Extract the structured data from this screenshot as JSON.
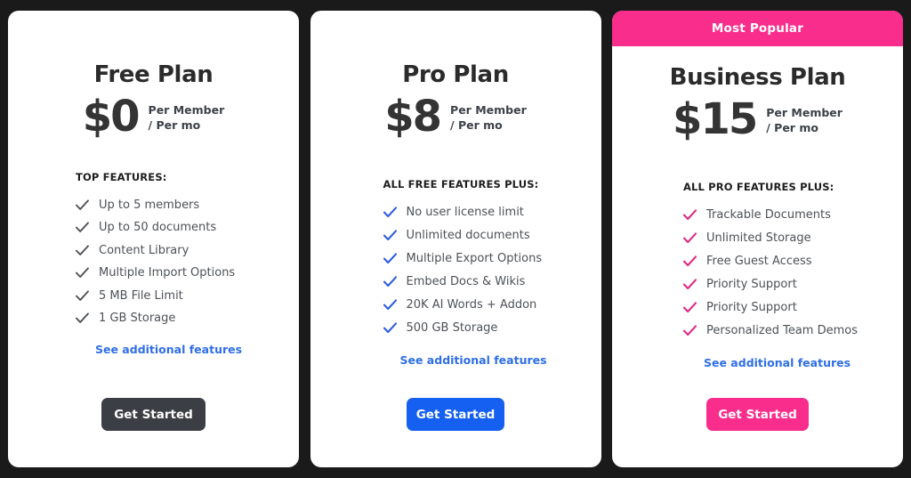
{
  "theme": {
    "page_background": "#1a1a1a",
    "card_background": "#ffffff",
    "accent_pink": "#f92d8b",
    "accent_blue": "#1560f0",
    "accent_dark": "#3b3e45",
    "link_blue": "#2f6fe4",
    "check_dark": "#4d5156",
    "text_body": "#4d5156",
    "text_heading": "#2b2b2b"
  },
  "plans": [
    {
      "id": "free",
      "name": "Free Plan",
      "price": "$0",
      "unit_line1": "Per Member",
      "unit_line2": "/ Per mo",
      "features_heading": "TOP FEATURES:",
      "features": [
        "Up to 5 members",
        "Up to 50 documents",
        "Content Library",
        "Multiple Import Options",
        "5 MB File Limit",
        "1 GB Storage"
      ],
      "additional_link": "See additional features",
      "cta_label": "Get Started",
      "badge": null,
      "check_color": "#4d5156",
      "cta_color": "#3b3e45",
      "link_color": "#2f6fe4"
    },
    {
      "id": "pro",
      "name": "Pro Plan",
      "price": "$8",
      "unit_line1": "Per Member",
      "unit_line2": "/ Per mo",
      "features_heading": "ALL FREE FEATURES PLUS:",
      "features": [
        "No user license limit",
        "Unlimited documents",
        "Multiple Export Options",
        "Embed Docs & Wikis",
        "20K AI Words + Addon",
        "500 GB Storage"
      ],
      "additional_link": "See additional features",
      "cta_label": "Get Started",
      "badge": null,
      "check_color": "#2f5de0",
      "cta_color": "#1560f0",
      "link_color": "#2f6fe4"
    },
    {
      "id": "business",
      "name": "Business Plan",
      "price": "$15",
      "unit_line1": "Per Member",
      "unit_line2": "/ Per mo",
      "features_heading": "ALL PRO FEATURES PLUS:",
      "features": [
        "Trackable Documents",
        "Unlimited Storage",
        "Free Guest Access",
        "Priority Support",
        "Priority Support",
        "Personalized Team Demos"
      ],
      "additional_link": "See additional features",
      "cta_label": "Get Started",
      "badge": "Most Popular",
      "check_color": "#e02a83",
      "cta_color": "#f92d8b",
      "link_color": "#2f6fe4"
    }
  ],
  "icons": {
    "check": "check-icon"
  }
}
